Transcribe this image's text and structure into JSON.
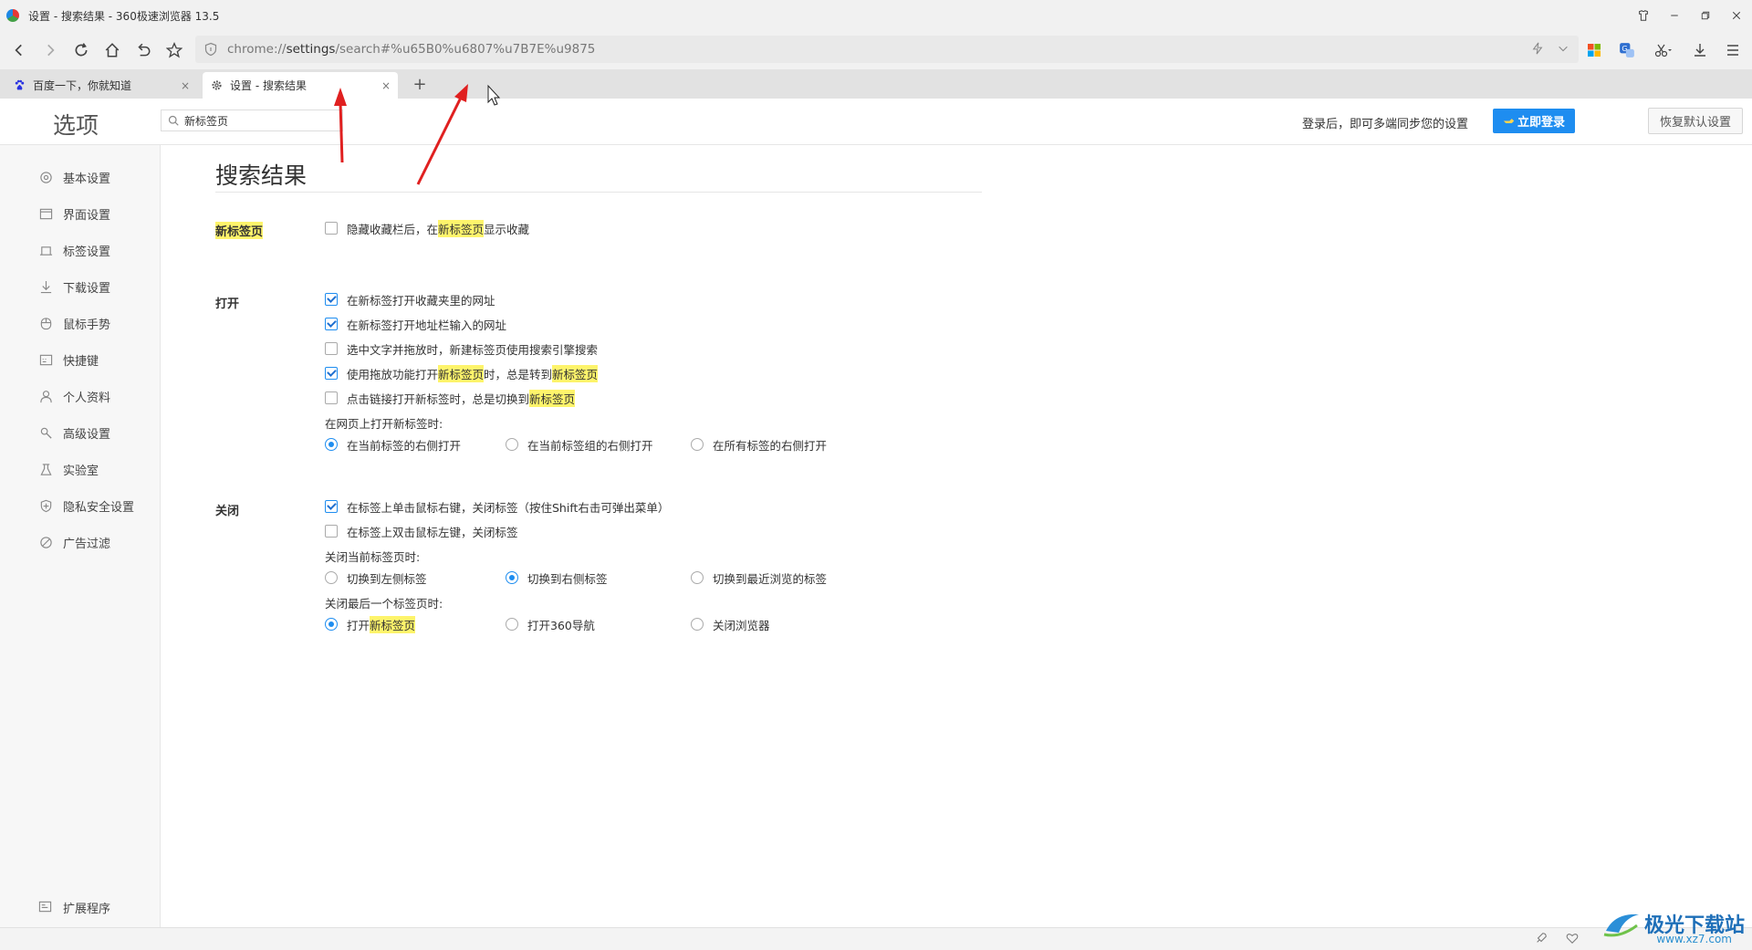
{
  "window": {
    "title": "设置 - 搜索结果 - 360极速浏览器 13.5"
  },
  "addressbar": {
    "url_prefix": "chrome://",
    "url_host": "settings",
    "url_path": "/search#%u65B0%u6807%u7B7E%u9875"
  },
  "tabs": [
    {
      "label": "百度一下，你就知道",
      "close": "×"
    },
    {
      "label": "设置 - 搜索结果",
      "close": "×"
    }
  ],
  "newtab_label": "+",
  "header": {
    "options_title": "选项",
    "search_value": "新标签页",
    "login_hint": "登录后，即可多端同步您的设置",
    "login_button": "立即登录",
    "reset_button": "恢复默认设置"
  },
  "sidebar": {
    "items": [
      {
        "label": "基本设置",
        "icon": "gear-icon"
      },
      {
        "label": "界面设置",
        "icon": "window-icon"
      },
      {
        "label": "标签设置",
        "icon": "tab-icon"
      },
      {
        "label": "下载设置",
        "icon": "download-icon"
      },
      {
        "label": "鼠标手势",
        "icon": "mouse-icon"
      },
      {
        "label": "快捷键",
        "icon": "keyboard-icon"
      },
      {
        "label": "个人资料",
        "icon": "user-icon"
      },
      {
        "label": "高级设置",
        "icon": "wrench-icon"
      },
      {
        "label": "实验室",
        "icon": "flask-icon"
      },
      {
        "label": "隐私安全设置",
        "icon": "shield-icon"
      },
      {
        "label": "广告过滤",
        "icon": "block-icon"
      }
    ],
    "extensions": "扩展程序"
  },
  "content": {
    "title": "搜索结果",
    "newtab_section": {
      "label": "新标签页",
      "option": {
        "before": "隐藏收藏栏后，在",
        "highlight": "新标签页",
        "after": "显示收藏",
        "checked": false
      }
    },
    "open_section": {
      "label": "打开",
      "options": [
        {
          "text": "在新标签打开收藏夹里的网址",
          "checked": true
        },
        {
          "text": "在新标签打开地址栏输入的网址",
          "checked": true
        },
        {
          "text": "选中文字并拖放时，新建标签页使用搜索引擎搜索",
          "checked": false
        }
      ],
      "option_drag": {
        "p1": "使用拖放功能打开",
        "h1": "新标签页",
        "p2": "时，总是转到",
        "h2": "新标签页",
        "checked": true
      },
      "option_click": {
        "p1": "点击链接打开新标签时，总是切换到",
        "h1": "新标签页",
        "checked": false
      },
      "open_position_label": "在网页上打开新标签时:",
      "open_position_options": [
        {
          "text": "在当前标签的右侧打开",
          "selected": true
        },
        {
          "text": "在当前标签组的右侧打开",
          "selected": false
        },
        {
          "text": "在所有标签的右侧打开",
          "selected": false
        }
      ]
    },
    "close_section": {
      "label": "关闭",
      "options": [
        {
          "text": "在标签上单击鼠标右键，关闭标签（按住Shift右击可弹出菜单）",
          "checked": true
        },
        {
          "text": "在标签上双击鼠标左键，关闭标签",
          "checked": false
        }
      ],
      "close_current_label": "关闭当前标签页时:",
      "close_current_options": [
        {
          "text": "切换到左侧标签",
          "selected": false
        },
        {
          "text": "切换到右侧标签",
          "selected": true
        },
        {
          "text": "切换到最近浏览的标签",
          "selected": false
        }
      ],
      "close_last_label": "关闭最后一个标签页时:",
      "close_last_options": [
        {
          "p1": "打开",
          "h1": "新标签页",
          "selected": true
        },
        {
          "text": "打开360导航",
          "selected": false
        },
        {
          "text": "关闭浏览器",
          "selected": false
        }
      ]
    }
  },
  "watermark": {
    "text": "极光下载站",
    "sub": "www.xz7.com"
  },
  "colors": {
    "accent": "#1e8df0",
    "highlight": "#fef46b",
    "arrow": "#e02020"
  }
}
